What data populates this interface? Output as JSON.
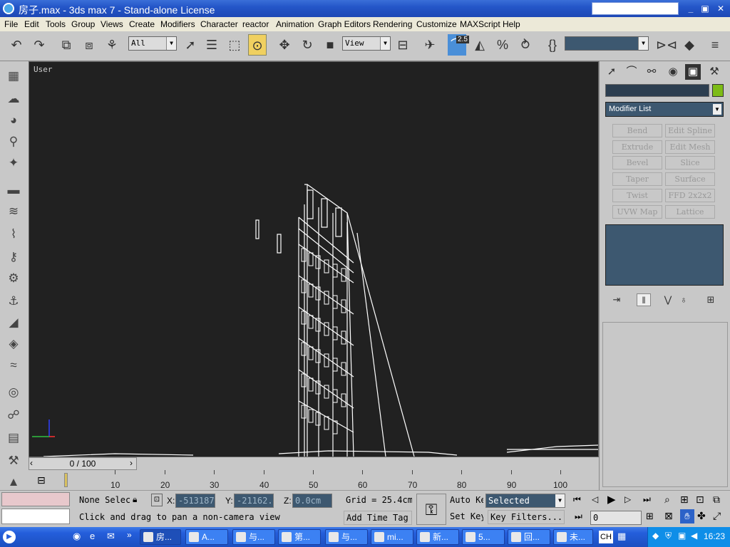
{
  "window": {
    "title": "房子.max - 3ds max 7  - Stand-alone License"
  },
  "menu": [
    "File",
    "Edit",
    "Tools",
    "Group",
    "Views",
    "Create",
    "Modifiers",
    "Character",
    "reactor",
    "Animation",
    "Graph Editors",
    "Rendering",
    "Customize",
    "MAXScript",
    "Help"
  ],
  "toolbar": {
    "selection_filter": "All",
    "reference_coord": "View",
    "snap_value": "2.5",
    "named_selection": ""
  },
  "viewport": {
    "label": "User"
  },
  "command_panel": {
    "modifier_list": "Modifier List",
    "object_name": "",
    "object_color": "#7dbc17",
    "modifier_buttons": [
      [
        "Bend",
        "Edit Spline"
      ],
      [
        "Extrude",
        "Edit Mesh"
      ],
      [
        "Bevel",
        "Slice"
      ],
      [
        "Taper",
        "Surface"
      ],
      [
        "Twist",
        "FFD 2x2x2"
      ],
      [
        "UVW Map",
        "Lattice"
      ]
    ]
  },
  "timeline": {
    "slider_label": "0 / 100",
    "ticks": [
      "10",
      "20",
      "30",
      "40",
      "50",
      "60",
      "70",
      "80",
      "90",
      "100"
    ]
  },
  "status": {
    "selection": "None Selec",
    "x_value": "-513187.",
    "y_value": "-21162.",
    "z_value": "0.0cm",
    "grid": "Grid = 25.4cm",
    "prompt": "Click and drag to pan a non-camera view",
    "add_time_tag": "Add Time Tag",
    "auto_key": "Auto Key",
    "set_key": "Set Key",
    "key_mode": "Selected",
    "key_filters": "Key Filters...",
    "current_frame": "0",
    "labels": {
      "x": "X:",
      "y": "Y:",
      "z": "Z:"
    }
  },
  "taskbar": {
    "items": [
      "房...",
      "A...",
      "与...",
      "第...",
      "与...",
      "mi...",
      "新...",
      "5...",
      "回...",
      "未..."
    ],
    "language": "CH",
    "clock": "16:23"
  }
}
